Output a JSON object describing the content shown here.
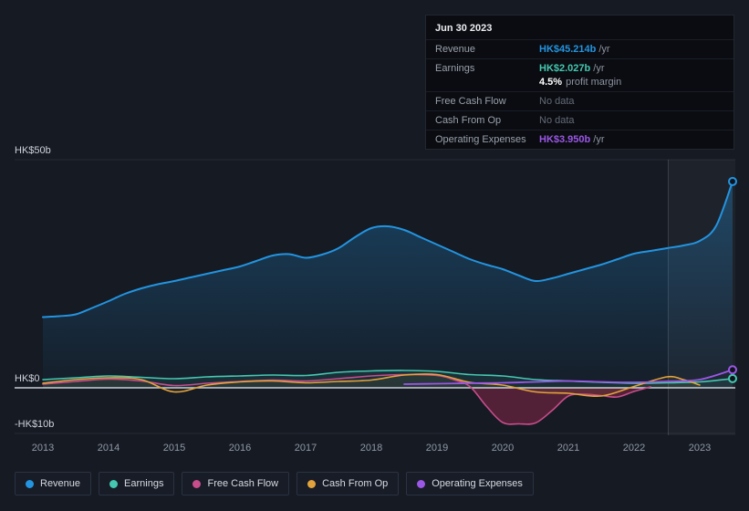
{
  "colors": {
    "revenue": "#2394df",
    "earnings": "#45c8b0",
    "free_cash_flow": "#c74d8c",
    "cash_from_op": "#e2a33d",
    "operating_expenses": "#9b57e6",
    "background": "#151a23",
    "zero_line": "#dde2ea"
  },
  "tooltip": {
    "date": "Jun 30 2023",
    "rows": {
      "revenue": {
        "label": "Revenue",
        "value": "HK$45.214b",
        "unit": "/yr"
      },
      "earnings": {
        "label": "Earnings",
        "value": "HK$2.027b",
        "unit": "/yr",
        "margin_value": "4.5%",
        "margin_label": "profit margin"
      },
      "free_cash_flow": {
        "label": "Free Cash Flow",
        "value": "No data"
      },
      "cash_from_op": {
        "label": "Cash From Op",
        "value": "No data"
      },
      "operating_expenses": {
        "label": "Operating Expenses",
        "value": "HK$3.950b",
        "unit": "/yr"
      }
    }
  },
  "legend": {
    "items": [
      {
        "label": "Revenue",
        "color": "#2394df"
      },
      {
        "label": "Earnings",
        "color": "#45c8b0"
      },
      {
        "label": "Free Cash Flow",
        "color": "#c74d8c"
      },
      {
        "label": "Cash From Op",
        "color": "#e2a33d"
      },
      {
        "label": "Operating Expenses",
        "color": "#9b57e6"
      }
    ]
  },
  "chart_data": {
    "type": "line",
    "unit": "HK$ billions per year",
    "x_ticks": [
      "2013",
      "2014",
      "2015",
      "2016",
      "2017",
      "2018",
      "2019",
      "2020",
      "2021",
      "2022",
      "2023"
    ],
    "y_ticks": [
      {
        "label": "HK$50b",
        "value": 50
      },
      {
        "label": "HK$0",
        "value": 0
      },
      {
        "label": "-HK$10b",
        "value": -10
      }
    ],
    "x_range": [
      2013,
      2023.5
    ],
    "ylim": [
      -13,
      52
    ],
    "grid": true,
    "legend_position": "bottom",
    "highlight_band_start_x": 2022.52,
    "series": [
      {
        "name": "Revenue",
        "color": "#2394df",
        "width": 2,
        "area": "gradient",
        "end_marker": true,
        "top": true,
        "points": [
          [
            2013,
            15.5
          ],
          [
            2013.25,
            15.7
          ],
          [
            2013.5,
            16.1
          ],
          [
            2013.75,
            17.5
          ],
          [
            2014,
            19
          ],
          [
            2014.25,
            20.6
          ],
          [
            2014.5,
            21.8
          ],
          [
            2014.75,
            22.7
          ],
          [
            2015,
            23.4
          ],
          [
            2015.25,
            24.2
          ],
          [
            2015.5,
            25
          ],
          [
            2015.75,
            25.8
          ],
          [
            2016,
            26.6
          ],
          [
            2016.25,
            27.8
          ],
          [
            2016.5,
            29
          ],
          [
            2016.75,
            29.3
          ],
          [
            2017,
            28.5
          ],
          [
            2017.25,
            29.2
          ],
          [
            2017.5,
            30.6
          ],
          [
            2017.75,
            33
          ],
          [
            2018,
            35
          ],
          [
            2018.25,
            35.4
          ],
          [
            2018.5,
            34.6
          ],
          [
            2018.75,
            33
          ],
          [
            2019,
            31.4
          ],
          [
            2019.25,
            29.8
          ],
          [
            2019.5,
            28.2
          ],
          [
            2019.75,
            27
          ],
          [
            2020,
            26
          ],
          [
            2020.25,
            24.6
          ],
          [
            2020.5,
            23.4
          ],
          [
            2020.75,
            24
          ],
          [
            2021,
            25
          ],
          [
            2021.25,
            26
          ],
          [
            2021.5,
            27
          ],
          [
            2021.75,
            28.2
          ],
          [
            2022,
            29.4
          ],
          [
            2022.25,
            30
          ],
          [
            2022.5,
            30.6
          ],
          [
            2022.75,
            31.2
          ],
          [
            2023,
            32.2
          ],
          [
            2023.25,
            35.5
          ],
          [
            2023.5,
            45.214
          ]
        ]
      },
      {
        "name": "Earnings",
        "color": "#45c8b0",
        "width": 1.6,
        "area": "tint",
        "area_color": "rgba(69,200,176,0.10)",
        "end_marker": true,
        "points": [
          [
            2013,
            1.8
          ],
          [
            2013.5,
            2.2
          ],
          [
            2014,
            2.6
          ],
          [
            2014.5,
            2.3
          ],
          [
            2015,
            2.0
          ],
          [
            2015.5,
            2.4
          ],
          [
            2016,
            2.6
          ],
          [
            2016.5,
            2.8
          ],
          [
            2017,
            2.7
          ],
          [
            2017.5,
            3.4
          ],
          [
            2018,
            3.7
          ],
          [
            2018.5,
            3.8
          ],
          [
            2019,
            3.6
          ],
          [
            2019.5,
            2.9
          ],
          [
            2020,
            2.6
          ],
          [
            2020.5,
            1.8
          ],
          [
            2021,
            1.5
          ],
          [
            2021.5,
            1.2
          ],
          [
            2022,
            1.0
          ],
          [
            2022.5,
            1.1
          ],
          [
            2023,
            1.3
          ],
          [
            2023.5,
            2.027
          ]
        ]
      },
      {
        "name": "Free Cash Flow",
        "color": "#c74d8c",
        "width": 1.6,
        "area": "negative",
        "area_color": "rgba(160,42,80,0.45)",
        "end_marker": false,
        "points": [
          [
            2013,
            0.8
          ],
          [
            2013.5,
            1.4
          ],
          [
            2014,
            1.9
          ],
          [
            2014.5,
            1.5
          ],
          [
            2015,
            0.5
          ],
          [
            2015.5,
            1.0
          ],
          [
            2016,
            1.4
          ],
          [
            2016.5,
            1.7
          ],
          [
            2017,
            1.5
          ],
          [
            2017.5,
            2.0
          ],
          [
            2018,
            2.6
          ],
          [
            2018.5,
            2.9
          ],
          [
            2019,
            2.7
          ],
          [
            2019.25,
            1.8
          ],
          [
            2019.5,
            0.3
          ],
          [
            2019.75,
            -4.0
          ],
          [
            2020,
            -7.6
          ],
          [
            2020.25,
            -7.9
          ],
          [
            2020.5,
            -7.7
          ],
          [
            2020.75,
            -5.0
          ],
          [
            2021,
            -1.8
          ],
          [
            2021.25,
            -1.4
          ],
          [
            2021.5,
            -1.7
          ],
          [
            2021.75,
            -2.0
          ],
          [
            2022,
            -0.8
          ],
          [
            2022.25,
            0.2
          ]
        ]
      },
      {
        "name": "Cash From Op",
        "color": "#e2a33d",
        "width": 1.6,
        "area": "tint",
        "area_color": "rgba(226,163,61,0.07)",
        "end_marker": false,
        "points": [
          [
            2013,
            1.0
          ],
          [
            2013.5,
            1.8
          ],
          [
            2014,
            2.2
          ],
          [
            2014.5,
            1.8
          ],
          [
            2015,
            -0.9
          ],
          [
            2015.5,
            0.6
          ],
          [
            2016,
            1.3
          ],
          [
            2016.5,
            1.5
          ],
          [
            2017,
            1.1
          ],
          [
            2017.5,
            1.4
          ],
          [
            2018,
            1.7
          ],
          [
            2018.5,
            2.8
          ],
          [
            2019,
            2.9
          ],
          [
            2019.5,
            1.2
          ],
          [
            2020,
            0.6
          ],
          [
            2020.5,
            -0.9
          ],
          [
            2021,
            -1.2
          ],
          [
            2021.5,
            -1.8
          ],
          [
            2022,
            0.3
          ],
          [
            2022.5,
            2.4
          ],
          [
            2022.75,
            1.8
          ],
          [
            2023,
            0.6
          ]
        ]
      },
      {
        "name": "Operating Expenses",
        "color": "#9b57e6",
        "width": 1.8,
        "area": null,
        "end_marker": true,
        "points": [
          [
            2018.5,
            0.8
          ],
          [
            2019,
            0.9
          ],
          [
            2019.5,
            1.0
          ],
          [
            2020,
            1.1
          ],
          [
            2020.5,
            1.3
          ],
          [
            2021,
            1.5
          ],
          [
            2021.5,
            1.3
          ],
          [
            2022,
            1.2
          ],
          [
            2022.5,
            1.4
          ],
          [
            2023,
            1.8
          ],
          [
            2023.5,
            3.95
          ]
        ]
      }
    ]
  }
}
